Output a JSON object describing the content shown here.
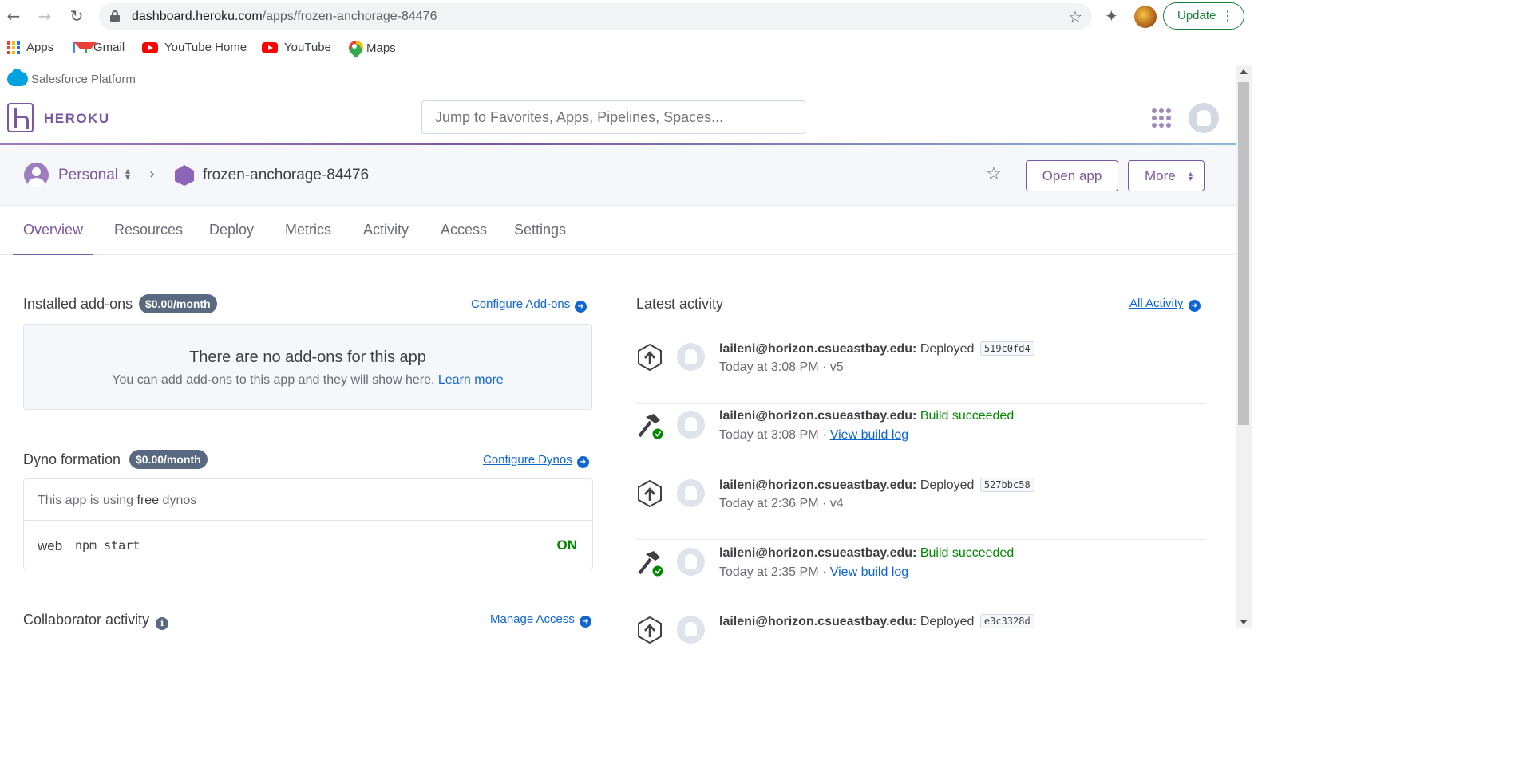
{
  "browser": {
    "url_domain": "dashboard.heroku.com",
    "url_path": "/apps/frozen-anchorage-84476",
    "update_label": "Update",
    "bookmarks": [
      {
        "label": "Apps",
        "icon": "apps-grid-icon"
      },
      {
        "label": "Gmail",
        "icon": "gmail-icon"
      },
      {
        "label": "YouTube Home",
        "icon": "youtube-icon"
      },
      {
        "label": "YouTube",
        "icon": "youtube-icon"
      },
      {
        "label": "Maps",
        "icon": "maps-icon"
      }
    ]
  },
  "salesforce": {
    "label": "Salesforce Platform"
  },
  "heroku": {
    "brand": "HEROKU",
    "search_placeholder": "Jump to Favorites, Apps, Pipelines, Spaces...",
    "accent_color": "#79589f"
  },
  "app_bar": {
    "team": "Personal",
    "app_name": "frozen-anchorage-84476",
    "open_app": "Open app",
    "more": "More"
  },
  "tabs": [
    "Overview",
    "Resources",
    "Deploy",
    "Metrics",
    "Activity",
    "Access",
    "Settings"
  ],
  "active_tab": "Overview",
  "addons": {
    "title": "Installed add-ons",
    "price": "$0.00/month",
    "configure": "Configure Add-ons",
    "empty_heading": "There are no add-ons for this app",
    "empty_text": "You can add add-ons to this app and they will show here.",
    "learn_more": "Learn more"
  },
  "dynos": {
    "title": "Dyno formation",
    "price": "$0.00/month",
    "configure": "Configure Dynos",
    "free_prefix": "This app is using",
    "free_word": "free",
    "free_suffix": "dynos",
    "process_type": "web",
    "command": "npm start",
    "state": "ON"
  },
  "collaborators": {
    "title": "Collaborator activity",
    "manage": "Manage Access"
  },
  "activity": {
    "title": "Latest activity",
    "all_link": "All Activity",
    "items": [
      {
        "icon": "deploy-icon",
        "user": "laileni@horizon.csueastbay.edu:",
        "action": "Deployed",
        "commit": "519c0fd4",
        "time": "Today at 3:08 PM · v5",
        "link": ""
      },
      {
        "icon": "build-icon",
        "user": "laileni@horizon.csueastbay.edu:",
        "action": "Build succeeded",
        "commit": "",
        "time": "Today at 3:08 PM · ",
        "link": "View build log"
      },
      {
        "icon": "deploy-icon",
        "user": "laileni@horizon.csueastbay.edu:",
        "action": "Deployed",
        "commit": "527bbc58",
        "time": "Today at 2:36 PM · v4",
        "link": ""
      },
      {
        "icon": "build-icon",
        "user": "laileni@horizon.csueastbay.edu:",
        "action": "Build succeeded",
        "commit": "",
        "time": "Today at 2:35 PM · ",
        "link": "View build log"
      },
      {
        "icon": "deploy-icon",
        "user": "laileni@horizon.csueastbay.edu:",
        "action": "Deployed",
        "commit": "e3c3328d",
        "time": "",
        "link": ""
      }
    ]
  }
}
